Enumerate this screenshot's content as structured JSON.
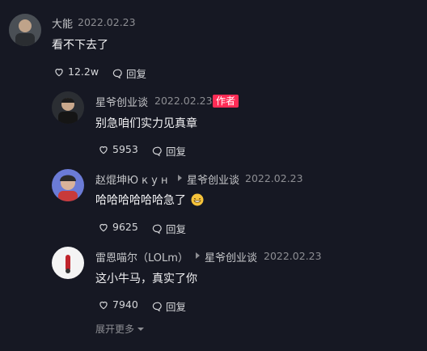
{
  "comments": [
    {
      "user": "大能",
      "date": "2022.02.23",
      "text": "看不下去了",
      "likes": "12.2w",
      "reply_label": "回复"
    }
  ],
  "replies": [
    {
      "user": "星爷创业谈",
      "date": "2022.02.23",
      "badge": "作者",
      "text": "别急咱们实力见真章",
      "likes": "5953",
      "reply_label": "回复"
    },
    {
      "user": "赵焜坤Ю к у н",
      "reply_to": "星爷创业谈",
      "date": "2022.02.23",
      "text": "哈哈哈哈哈哈急了",
      "likes": "9625",
      "reply_label": "回复"
    },
    {
      "user": "雷恩喵尔（LOLm）",
      "reply_to": "星爷创业谈",
      "date": "2022.02.23",
      "text": "这小牛马，真实了你",
      "likes": "7940",
      "reply_label": "回复"
    }
  ],
  "expand_more": "展开更多",
  "colors": {
    "background": "#161823",
    "badge": "#fe2c55",
    "muted": "#8d8e93"
  },
  "icons": [
    "heart-icon",
    "comment-icon",
    "triangle-right-icon",
    "chevron-down-icon",
    "grin-emoji-icon"
  ]
}
